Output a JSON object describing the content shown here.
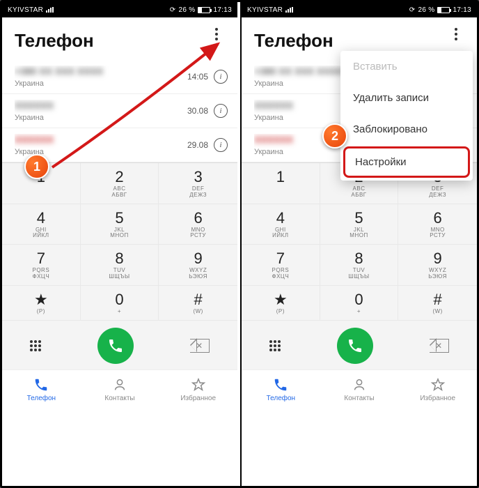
{
  "statusbar": {
    "carrier": "KYIVSTAR",
    "battery_pct": "26 %",
    "time": "17:13"
  },
  "header": {
    "title": "Телефон"
  },
  "calls": [
    {
      "name": "+380 XX XXX XXXX",
      "sub": "Украина",
      "time": "14:05",
      "red": false
    },
    {
      "name": "XXXXXX",
      "sub": "Украина",
      "time": "30.08",
      "red": false
    },
    {
      "name": "XXXXXX",
      "sub": "Украина",
      "time": "29.08",
      "red": true
    }
  ],
  "dialpad": [
    {
      "num": "1",
      "alpha": "",
      "cyr": ""
    },
    {
      "num": "2",
      "alpha": "ABC",
      "cyr": "АБВГ"
    },
    {
      "num": "3",
      "alpha": "DEF",
      "cyr": "ДЕЖЗ"
    },
    {
      "num": "4",
      "alpha": "GHI",
      "cyr": "ИЙКЛ"
    },
    {
      "num": "5",
      "alpha": "JKL",
      "cyr": "МНОП"
    },
    {
      "num": "6",
      "alpha": "MNO",
      "cyr": "РСТУ"
    },
    {
      "num": "7",
      "alpha": "PQRS",
      "cyr": "ФХЦЧ"
    },
    {
      "num": "8",
      "alpha": "TUV",
      "cyr": "ШЩЪЫ"
    },
    {
      "num": "9",
      "alpha": "WXYZ",
      "cyr": "ЬЭЮЯ"
    },
    {
      "num": "★",
      "alpha": "(P)",
      "cyr": ""
    },
    {
      "num": "0",
      "alpha": "+",
      "cyr": ""
    },
    {
      "num": "#",
      "alpha": "(W)",
      "cyr": ""
    }
  ],
  "nav": {
    "phone": "Телефон",
    "contacts": "Контакты",
    "fav": "Избранное"
  },
  "dropdown": {
    "paste": "Вставить",
    "delete": "Удалить записи",
    "blocked": "Заблокировано",
    "settings": "Настройки"
  },
  "markers": {
    "one": "1",
    "two": "2"
  },
  "icons": {
    "rot": "⟳"
  }
}
